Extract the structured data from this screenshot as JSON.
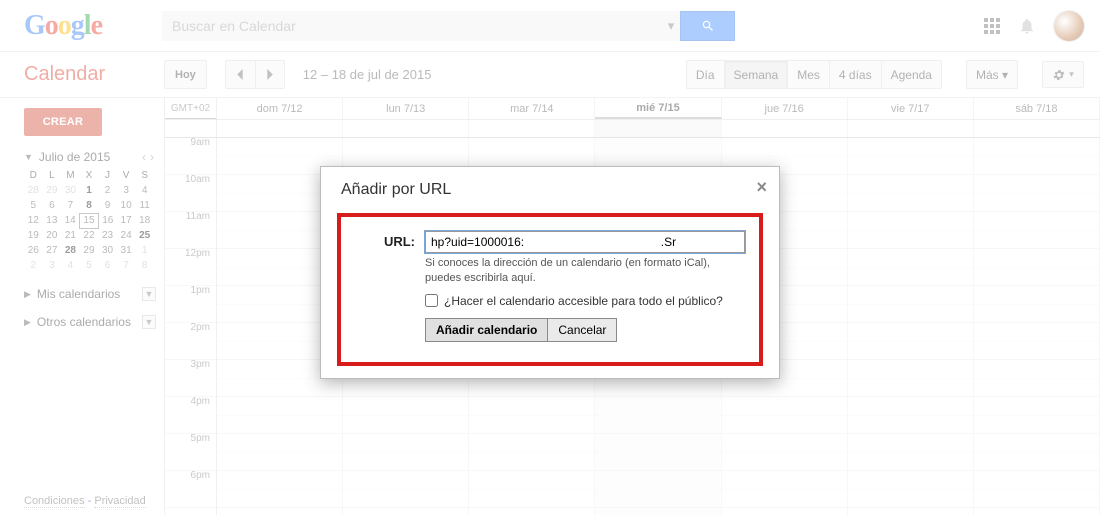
{
  "search": {
    "placeholder": "Buscar en Calendar"
  },
  "app_title": "Calendar",
  "today_btn": "Hoy",
  "date_range": "12 – 18 de jul de 2015",
  "views": {
    "day": "Día",
    "week": "Semana",
    "month": "Mes",
    "fourdays": "4 días",
    "agenda": "Agenda",
    "more": "Más"
  },
  "create_btn": "CREAR",
  "minical": {
    "month": "Julio de 2015",
    "dow": [
      "D",
      "L",
      "M",
      "X",
      "J",
      "V",
      "S"
    ],
    "rows": [
      [
        {
          "n": "28",
          "dim": true
        },
        {
          "n": "29",
          "dim": true
        },
        {
          "n": "30",
          "dim": true
        },
        {
          "n": "1",
          "bold": true
        },
        {
          "n": "2"
        },
        {
          "n": "3"
        },
        {
          "n": "4"
        }
      ],
      [
        {
          "n": "5"
        },
        {
          "n": "6"
        },
        {
          "n": "7"
        },
        {
          "n": "8",
          "bold": true
        },
        {
          "n": "9"
        },
        {
          "n": "10"
        },
        {
          "n": "11"
        }
      ],
      [
        {
          "n": "12"
        },
        {
          "n": "13"
        },
        {
          "n": "14"
        },
        {
          "n": "15",
          "today": true
        },
        {
          "n": "16"
        },
        {
          "n": "17"
        },
        {
          "n": "18"
        }
      ],
      [
        {
          "n": "19"
        },
        {
          "n": "20"
        },
        {
          "n": "21"
        },
        {
          "n": "22"
        },
        {
          "n": "23"
        },
        {
          "n": "24"
        },
        {
          "n": "25",
          "bold": true
        }
      ],
      [
        {
          "n": "26"
        },
        {
          "n": "27"
        },
        {
          "n": "28",
          "bold": true
        },
        {
          "n": "29"
        },
        {
          "n": "30"
        },
        {
          "n": "31"
        },
        {
          "n": "1",
          "dim": true
        }
      ],
      [
        {
          "n": "2",
          "dim": true
        },
        {
          "n": "3",
          "dim": true
        },
        {
          "n": "4",
          "dim": true
        },
        {
          "n": "5",
          "dim": true
        },
        {
          "n": "6",
          "dim": true
        },
        {
          "n": "7",
          "dim": true
        },
        {
          "n": "8",
          "dim": true
        }
      ]
    ]
  },
  "my_cal_label": "Mis calendarios",
  "other_cal_label": "Otros calendarios",
  "footer": {
    "terms": "Condiciones",
    "privacy": "Privacidad",
    "sep": " - "
  },
  "timezone": "GMT+02",
  "day_headers": [
    "dom 7/12",
    "lun 7/13",
    "mar 7/14",
    "mié 7/15",
    "jue 7/16",
    "vie 7/17",
    "sáb 7/18"
  ],
  "today_index": 3,
  "time_labels": [
    "9am",
    "10am",
    "11am",
    "12pm",
    "1pm",
    "2pm",
    "3pm",
    "4pm",
    "5pm",
    "6pm"
  ],
  "modal": {
    "title": "Añadir por URL",
    "url_label": "URL:",
    "url_value": "hp?uid=1000016:                                         .Sr",
    "help": "Si conoces la dirección de un calendario (en formato iCal), puedes escribirla aquí.",
    "public_label": "¿Hacer el calendario accesible para todo el público?",
    "add_btn": "Añadir calendario",
    "cancel_btn": "Cancelar"
  }
}
